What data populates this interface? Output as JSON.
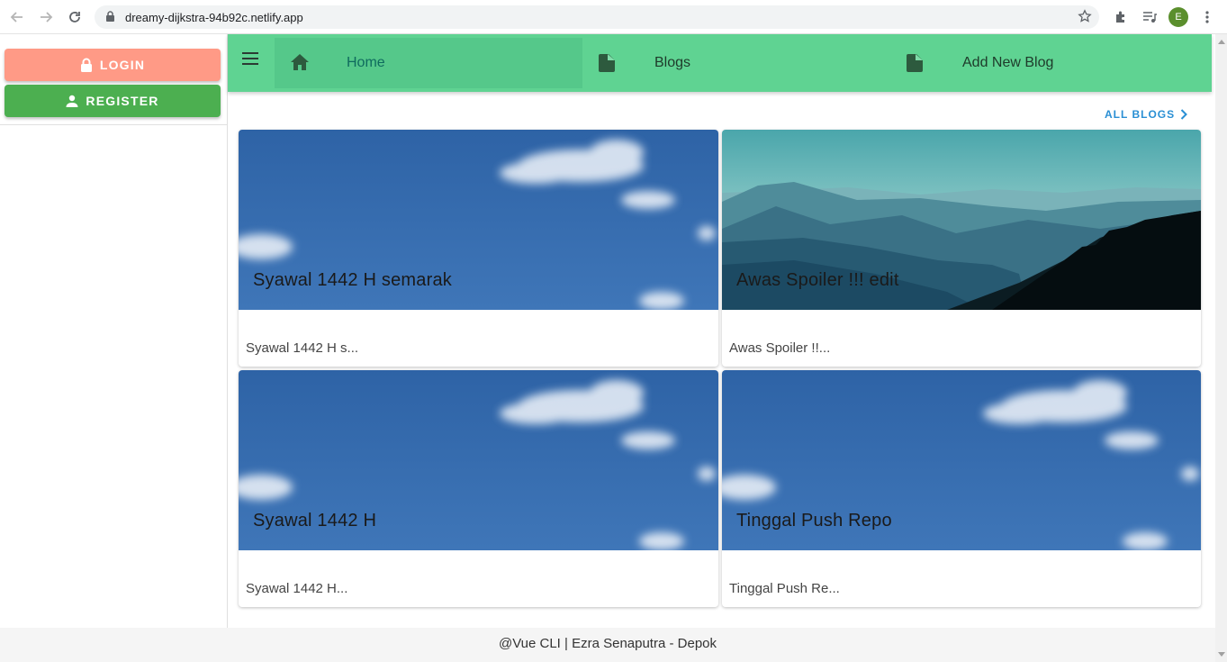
{
  "browser": {
    "url": "dreamy-dijkstra-94b92c.netlify.app",
    "profile_initial": "E",
    "profile_color": "#5b8f2d"
  },
  "sidebar": {
    "login_label": "LOGIN",
    "register_label": "REGISTER",
    "login_color": "#ff9a86",
    "register_color": "#4caf50"
  },
  "appbar": {
    "color": "#5fd392",
    "tabs": [
      {
        "label": "Home",
        "icon": "home-icon",
        "active": true
      },
      {
        "label": "Blogs",
        "icon": "document-icon",
        "active": false
      },
      {
        "label": "Add New Blog",
        "icon": "document-icon",
        "active": false
      }
    ]
  },
  "content": {
    "all_blogs_label": "ALL BLOGS",
    "cards": [
      {
        "title": "Syawal 1442 H semarak",
        "excerpt": "Syawal 1442 H s...",
        "image": "sky-with-clouds"
      },
      {
        "title": "Awas Spoiler !!! edit",
        "excerpt": "Awas Spoiler !!...",
        "image": "misty-mountains"
      },
      {
        "title": "Syawal 1442 H",
        "excerpt": "Syawal 1442 H...",
        "image": "sky-with-clouds"
      },
      {
        "title": "Tinggal Push Repo",
        "excerpt": "Tinggal Push Re...",
        "image": "sky-with-clouds"
      }
    ]
  },
  "footer": {
    "text": "@Vue CLI | Ezra Senaputra - Depok"
  }
}
